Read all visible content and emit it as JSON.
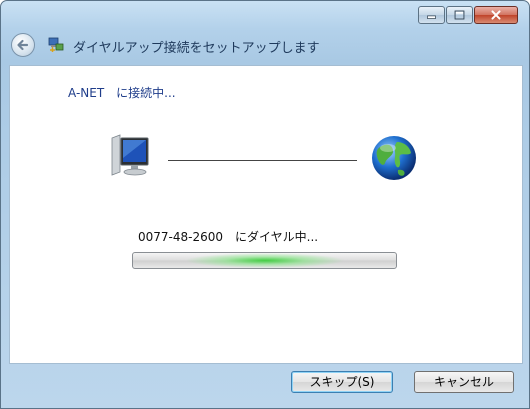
{
  "wizard": {
    "title": "ダイヤルアップ接続をセットアップします"
  },
  "status": {
    "connecting": "A-NET　に接続中...",
    "dialing": "0077-48-2600　にダイヤル中...",
    "progress": 0.5
  },
  "buttons": {
    "skip": "スキップ(S)",
    "cancel": "キャンセル"
  },
  "icons": {
    "back": "back-arrow-icon",
    "wizard": "network-connection-icon",
    "computer": "computer-icon",
    "internet": "globe-icon",
    "minimize": "minimize-icon",
    "maximize": "maximize-icon",
    "close": "close-icon"
  },
  "colors": {
    "status_text": "#1f3d8a",
    "progress_green": "#3ccd3c",
    "close_button": "#c0432a"
  }
}
